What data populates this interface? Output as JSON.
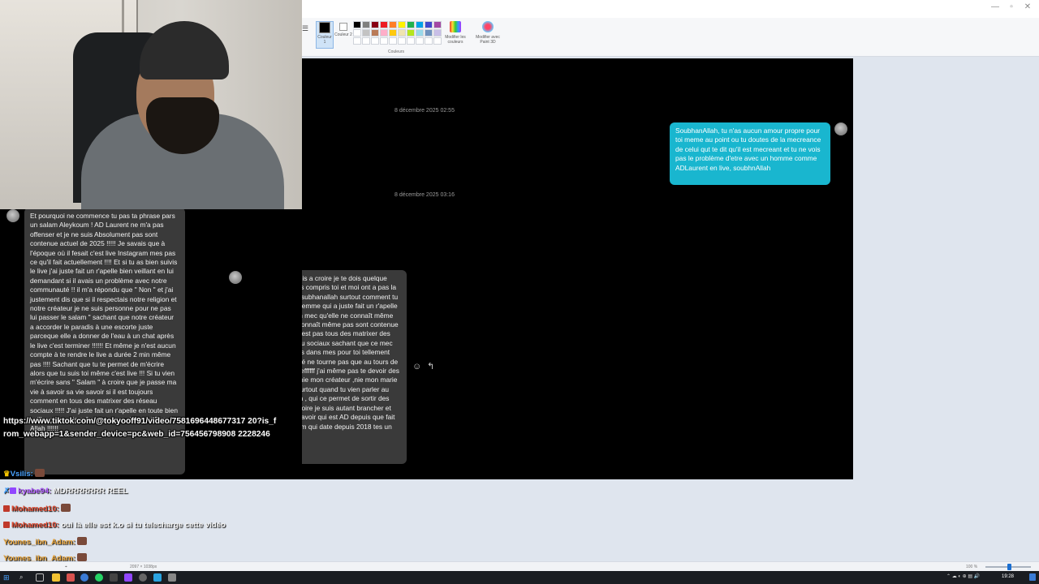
{
  "paint": {
    "color1_label": "Couleur 1",
    "color2_label": "Couleur 2",
    "edit_colors_label": "Modifier les couleurs",
    "paint3d_label": "Modifier avec Paint 3D",
    "group_label": "Couleurs",
    "palette": [
      "#000000",
      "#7f7f7f",
      "#880015",
      "#ed1c24",
      "#ff7f27",
      "#fff200",
      "#22b14c",
      "#00a2e8",
      "#3f48cc",
      "#a349a4",
      "#ffffff",
      "#c3c3c3",
      "#b97a57",
      "#ffaec9",
      "#ffc90e",
      "#efe4b0",
      "#b5e61d",
      "#99d9ea",
      "#7092be",
      "#c8bfe7",
      "#ffffff",
      "#ffffff",
      "#ffffff",
      "#ffffff",
      "#ffffff",
      "#ffffff",
      "#ffffff",
      "#ffffff",
      "#ffffff",
      "#ffffff"
    ],
    "color1": "#000000",
    "color2": "#ffffff"
  },
  "chat": {
    "date1": "8 décembre 2025 02:55",
    "date2": "8 décembre 2025 03:16",
    "my_message": "SoubhanAllah, tu n'as aucun amour propre pour toi meme au point ou tu doutes de la mecreance de celui qut te dit qu'il est mecreant et tu ne vois pas le problème d'etre avec un homme comme ADLaurent en live, soubhnAllah",
    "their_message": "Tu est trop Impolis a croire je te dois quelque chose !!!! J'ai pas compris toi et moi ont a pas la même vision du subhanallah surtout comment tu t'adresse à une femme qui a juste fait un r'apelle bien veillant à un mec qu'elle ne connaît même pas !!!!! Qui ne connaît même pas sont contenue actuel !!!!!!!! Ont est pas tous des matrixer des live et des réseau sociaux sachant que ce mec n'apparais jamais dans mes pour toi tellement que mon actualité ne tourne pas que au tours de AD Laurent !! Breffffff j'ai même pas te devoir des compte  tu n'est nie mon créateur ,nie mon marie , nie personne surtout quand tu vien parler au gens sans raison , qui ce permet de sortir des subhanallah a croire je suis autant brancher et accro a vouloir savoir qui est AD depuis que fait ses live Instagram qui date depuis 2018 tes un fou toi !",
    "left_message": "Et pourquoi ne commence tu pas ta phrase pars un salam Aleykoum ! AD Laurent ne m'a pas offenser et je ne suis Absolument pas sont contenue actuel de 2025 !!!!! Je savais que à l'époque où il fesait c'est live Instagram mes pas ce qu'il fait actuellement !!!! Et si tu as bien suivis le live j'ai juste fait un r'apelle bien veillant en lui demandant si il avais un problème avec notre communauté !! il m'a répondu que \" Non \" et j'ai justement dis que si il respectais notre religion et notre créateur je ne suis personne pour ne pas lui passer le salam \" sachant que notre créateur a accorder le paradis à une escorte juste parceque elle a donner de l'eau à un chat après le live c'est terminer !!!!!! Et même je n'est aucun compte à te rendre le live a durée 2 min même pas !!!! Sachant que tu te permet de m'écrire alors que tu suis toi même c'est live !!! Si tu vien m'écrire sans \" Salam \" à croire que je passe ma vie à savoir sa vie savoir si il est toujours comment en tous des matrixer des réseau sociaux !!!!! J'ai juste fait un r'apelle en toute bien veillance savais même pas que c'était lui Pars Allah !!!!!!"
  },
  "overlay": {
    "link_text": "https://www.tiktok.com/@tokyooff91/video/7581696448677317 20?is_from_webapp=1&sender_device=pc&web_id=756456798908 2228246",
    "lines": [
      {
        "user": "Vsilis:",
        "msg": "",
        "color": "#4aa3ff"
      },
      {
        "user": "kyabe94:",
        "msg": "MDRRRRRRR REEL",
        "color": "#b05cff"
      },
      {
        "user": "Mohamed10:",
        "msg": "",
        "color": "#e0482e"
      },
      {
        "user": "Mohamed10:",
        "msg": "oui là elle est k.o si tu telecharge cette vidéo",
        "color": "#e0482e"
      },
      {
        "user": "Younes_ibn_Adam:",
        "msg": "",
        "color": "#e8a43a"
      },
      {
        "user": "Younes_ibn_Adam:",
        "msg": "",
        "color": "#e8a43a"
      }
    ]
  },
  "statusbar": {
    "dims": "2097 × 1038px",
    "zoom": "100 %"
  },
  "taskbar": {
    "time": "19:28"
  }
}
